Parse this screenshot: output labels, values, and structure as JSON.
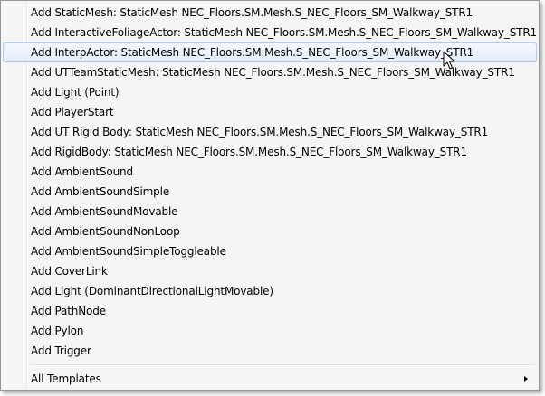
{
  "menu": {
    "items": [
      {
        "label": "Add StaticMesh: StaticMesh NEC_Floors.SM.Mesh.S_NEC_Floors_SM_Walkway_STR1"
      },
      {
        "label": "Add InteractiveFoliageActor: StaticMesh NEC_Floors.SM.Mesh.S_NEC_Floors_SM_Walkway_STR1"
      },
      {
        "label": "Add InterpActor: StaticMesh NEC_Floors.SM.Mesh.S_NEC_Floors_SM_Walkway_STR1",
        "highlighted": true
      },
      {
        "label": "Add UTTeamStaticMesh: StaticMesh NEC_Floors.SM.Mesh.S_NEC_Floors_SM_Walkway_STR1"
      },
      {
        "label": "Add Light (Point)"
      },
      {
        "label": "Add PlayerStart"
      },
      {
        "label": "Add UT Rigid Body: StaticMesh NEC_Floors.SM.Mesh.S_NEC_Floors_SM_Walkway_STR1"
      },
      {
        "label": "Add RigidBody: StaticMesh NEC_Floors.SM.Mesh.S_NEC_Floors_SM_Walkway_STR1"
      },
      {
        "label": "Add AmbientSound"
      },
      {
        "label": "Add AmbientSoundSimple"
      },
      {
        "label": "Add AmbientSoundMovable"
      },
      {
        "label": "Add AmbientSoundNonLoop"
      },
      {
        "label": "Add AmbientSoundSimpleToggleable"
      },
      {
        "label": "Add CoverLink"
      },
      {
        "label": "Add Light (DominantDirectionalLightMovable)"
      },
      {
        "label": "Add PathNode"
      },
      {
        "label": "Add Pylon"
      },
      {
        "label": "Add Trigger"
      }
    ],
    "all_templates_label": "All Templates",
    "submenu_icon": "chevron-right-icon",
    "highlight_color": "#e3eefb",
    "highlight_border": "#aeccf1"
  }
}
